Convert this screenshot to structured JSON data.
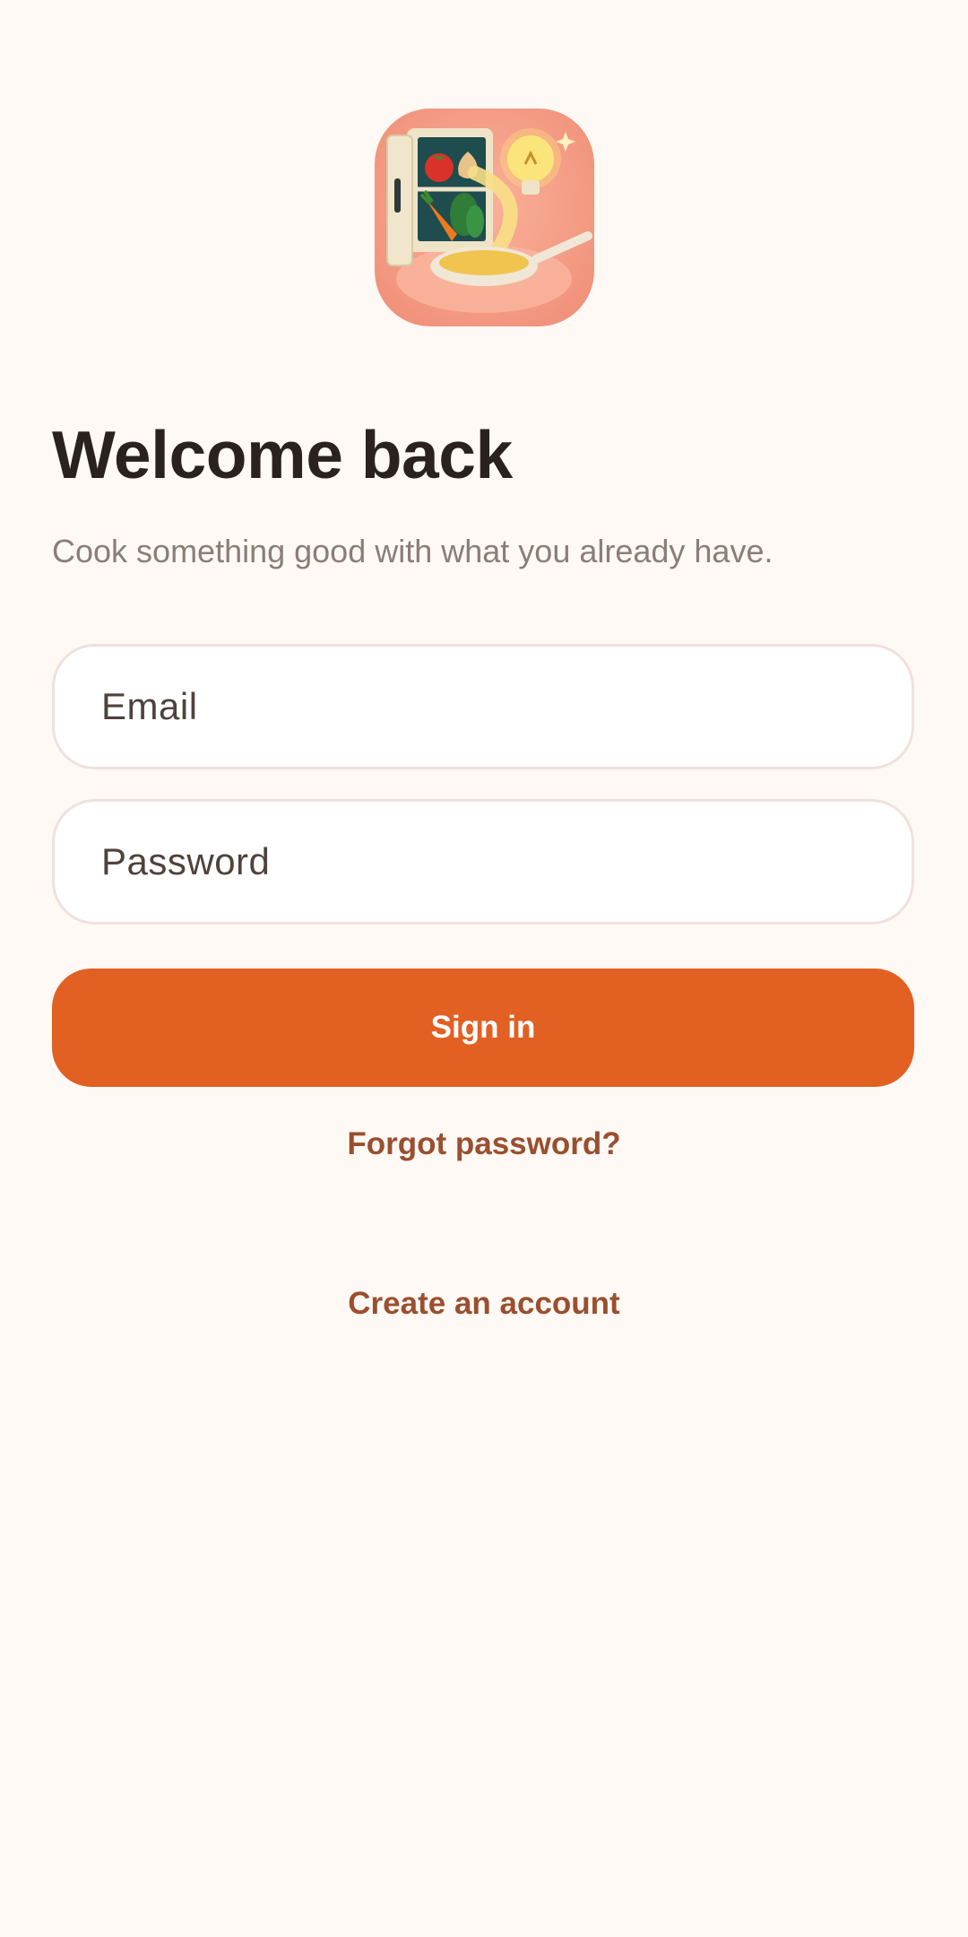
{
  "logo": {
    "icon": "fridge-pan-lightbulb-icon",
    "colors": {
      "background": "#f49b84",
      "accent": "#e26022"
    }
  },
  "header": {
    "title": "Welcome back",
    "subtitle": "Cook something good with what you already have."
  },
  "form": {
    "email_placeholder": "Email",
    "password_placeholder": "Password",
    "submit_label": "Sign in"
  },
  "links": {
    "forgot_password": "Forgot password?",
    "create_account": "Create an account"
  }
}
